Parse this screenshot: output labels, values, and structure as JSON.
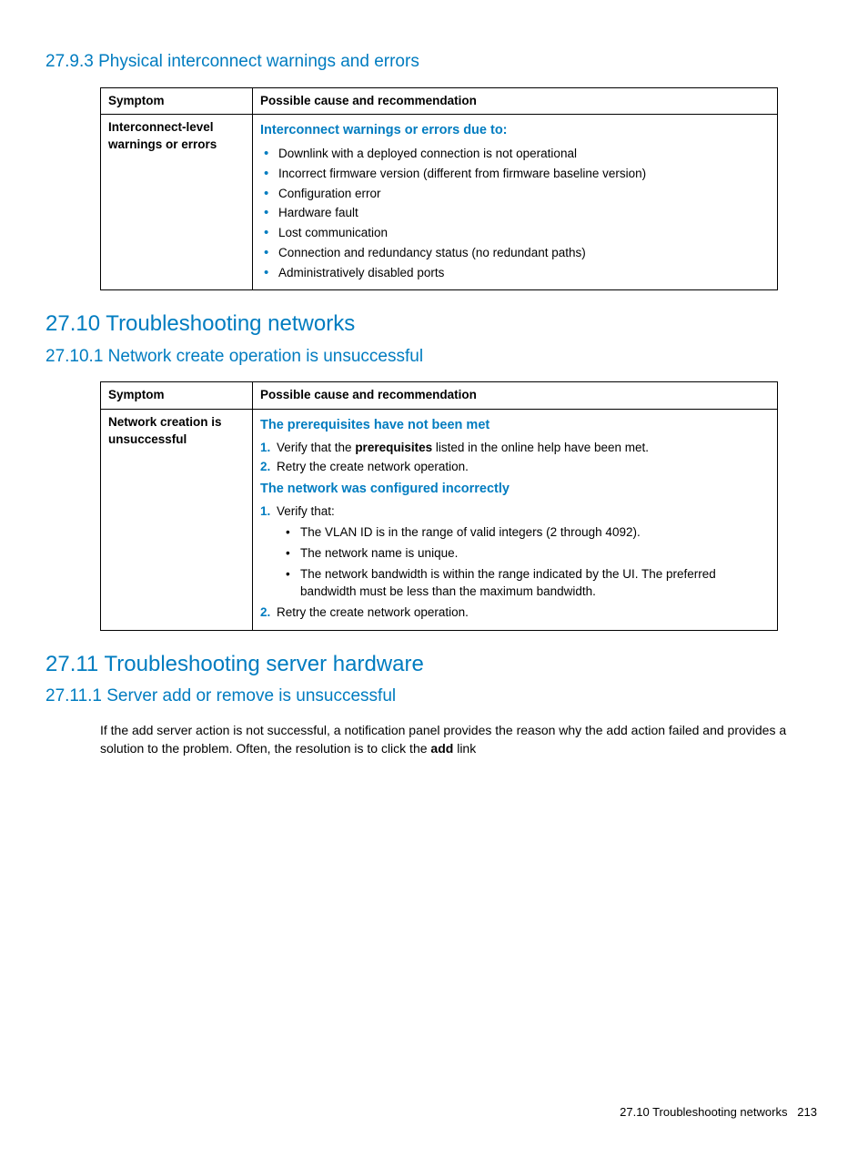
{
  "section_27_9_3": {
    "heading": "27.9.3 Physical interconnect warnings and errors",
    "table": {
      "col_symptom": "Symptom",
      "col_cause": "Possible cause and recommendation",
      "symptom": "Interconnect-level warnings or errors",
      "cause_title": "Interconnect warnings or errors due to:",
      "bullets": [
        "Downlink with a deployed connection is not operational",
        "Incorrect firmware version (different from firmware baseline version)",
        "Configuration error",
        "Hardware fault",
        "Lost communication",
        "Connection and redundancy status (no redundant paths)",
        "Administratively disabled ports"
      ]
    }
  },
  "section_27_10": {
    "heading": "27.10 Troubleshooting networks"
  },
  "section_27_10_1": {
    "heading": "27.10.1 Network create operation is unsuccessful",
    "table": {
      "col_symptom": "Symptom",
      "col_cause": "Possible cause and recommendation",
      "symptom": "Network creation is unsuccessful",
      "cause1_title": "The prerequisites have not been met",
      "cause1_step1_a": "Verify that the ",
      "cause1_step1_b": "prerequisites",
      "cause1_step1_c": " listed in the online help have been met.",
      "cause1_step2": "Retry the create network operation.",
      "cause2_title": "The network was configured incorrectly",
      "cause2_step1": "Verify that:",
      "cause2_sub": [
        "The VLAN ID is in the range of valid integers (2 through 4092).",
        "The network name is unique.",
        "The network bandwidth is within the range indicated by the UI. The preferred bandwidth must be less than the maximum bandwidth."
      ],
      "cause2_step2": "Retry the create network operation."
    }
  },
  "section_27_11": {
    "heading": "27.11 Troubleshooting server hardware"
  },
  "section_27_11_1": {
    "heading": "27.11.1 Server add or remove is unsuccessful",
    "para_a": "If the add server action is not successful, a notification panel provides the reason why the add action failed and provides a solution to the problem. Often, the resolution is to click the ",
    "para_b": "add",
    "para_c": " link"
  },
  "footer": {
    "section": "27.10 Troubleshooting networks",
    "page": "213"
  }
}
